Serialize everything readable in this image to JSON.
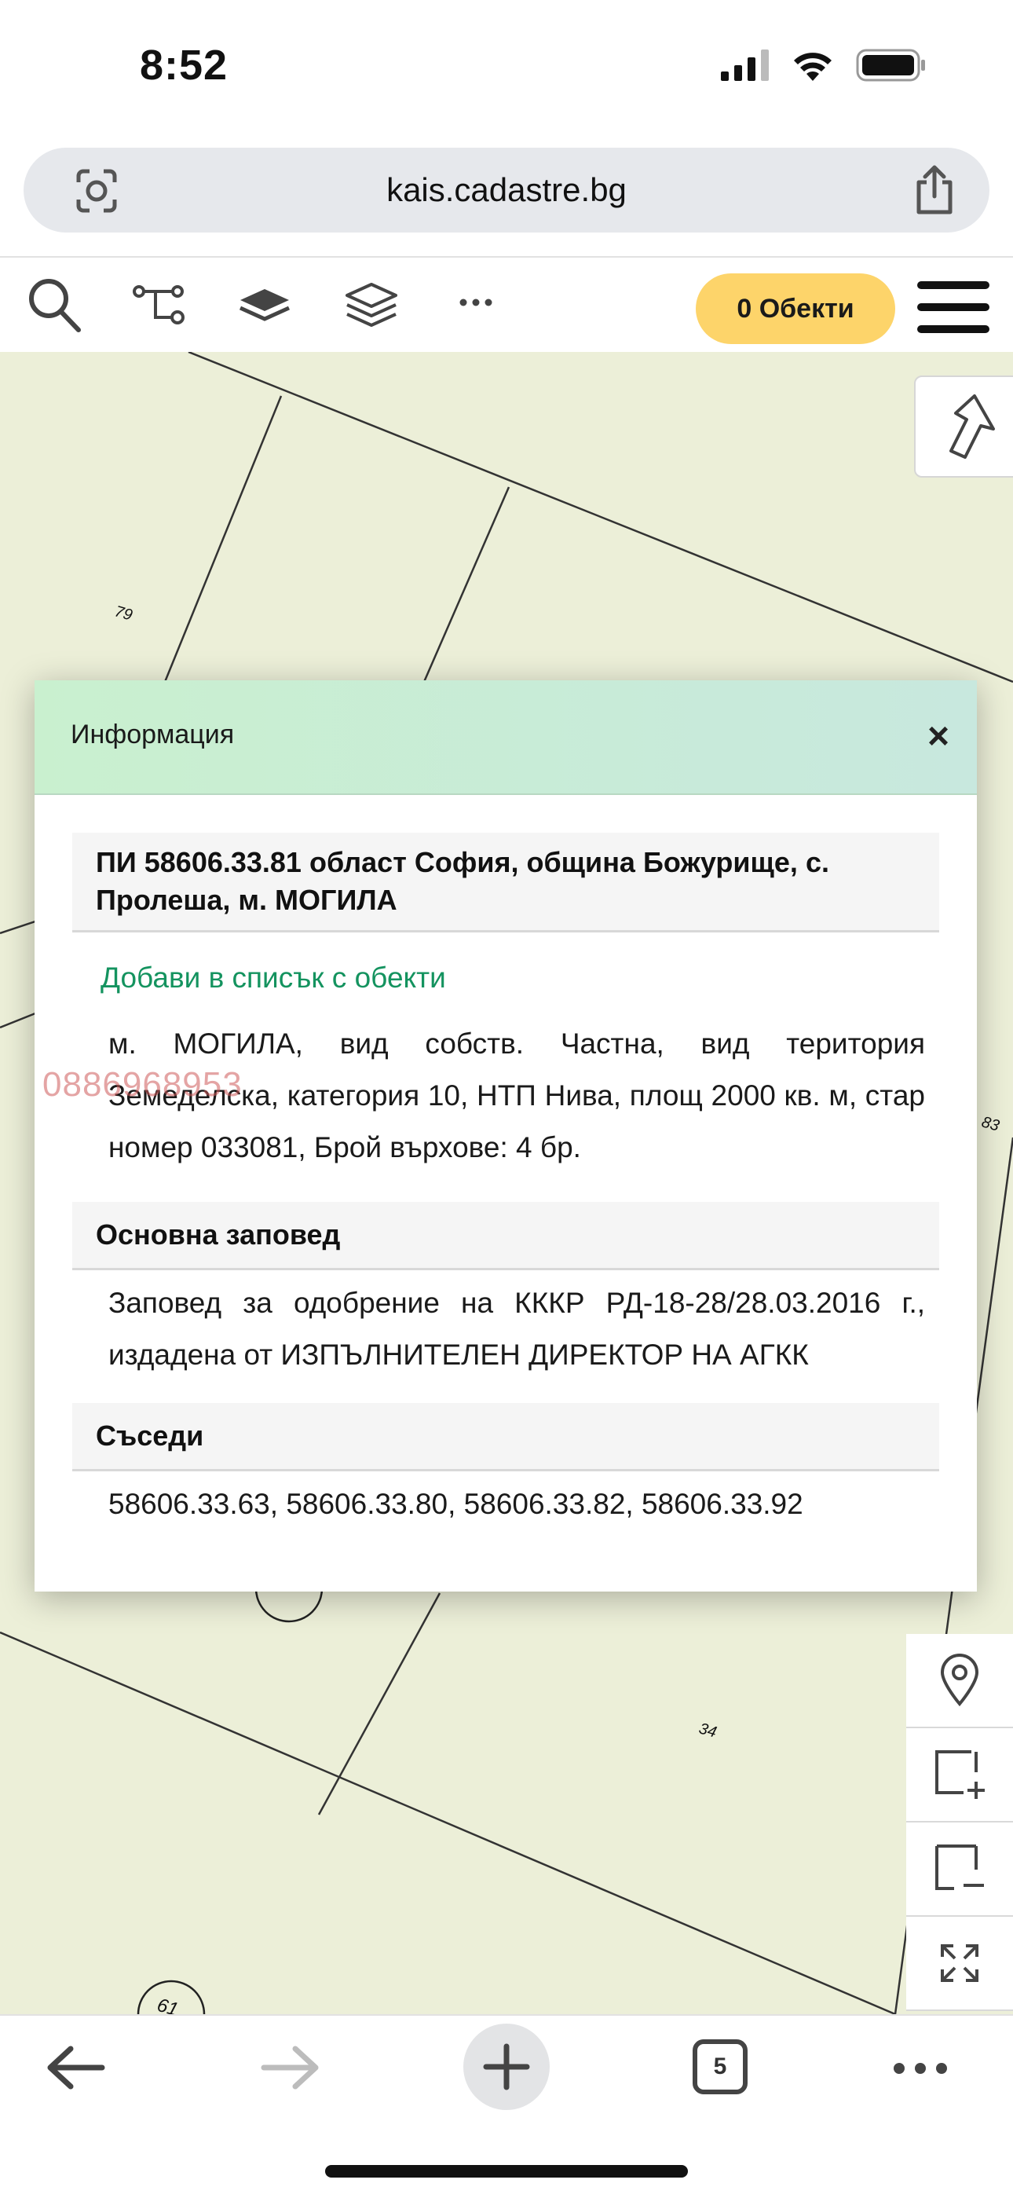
{
  "status_bar": {
    "time": "8:52"
  },
  "browser": {
    "url": "kais.cadastre.bg",
    "open_tabs": "5"
  },
  "toolbar": {
    "objects_label": "0 Обекти"
  },
  "map": {
    "parcel_labels": [
      "79",
      "83",
      "34",
      "61"
    ],
    "background_color": "#ecefd8"
  },
  "dialog": {
    "title": "Информация",
    "close_label": "×",
    "heading": "ПИ 58606.33.81 област София, община Божурище, с. Пролеша, м. МОГИЛА",
    "add_link": "Добави в списък с обекти",
    "details": "м. МОГИЛА, вид собств. Частна, вид територия Земеделска, категория 10, НТП Нива, площ 2000 кв. м, стар номер 033081, Брой върхове: 4 бр.",
    "order_heading": "Основна заповед",
    "order_text": "Заповед за одобрение на КККР РД-18-28/28.03.2016 г., издадена от ИЗПЪЛНИТЕЛЕН ДИРЕКТОР НА АГКК",
    "neighbors_heading": "Съседи",
    "neighbors_text": "58606.33.63, 58606.33.80, 58606.33.82, 58606.33.92"
  },
  "watermark": "0886968953",
  "colors": {
    "accent_yellow": "#fdd46a",
    "link_green": "#14935f",
    "header_green": "#c9f0cf"
  }
}
